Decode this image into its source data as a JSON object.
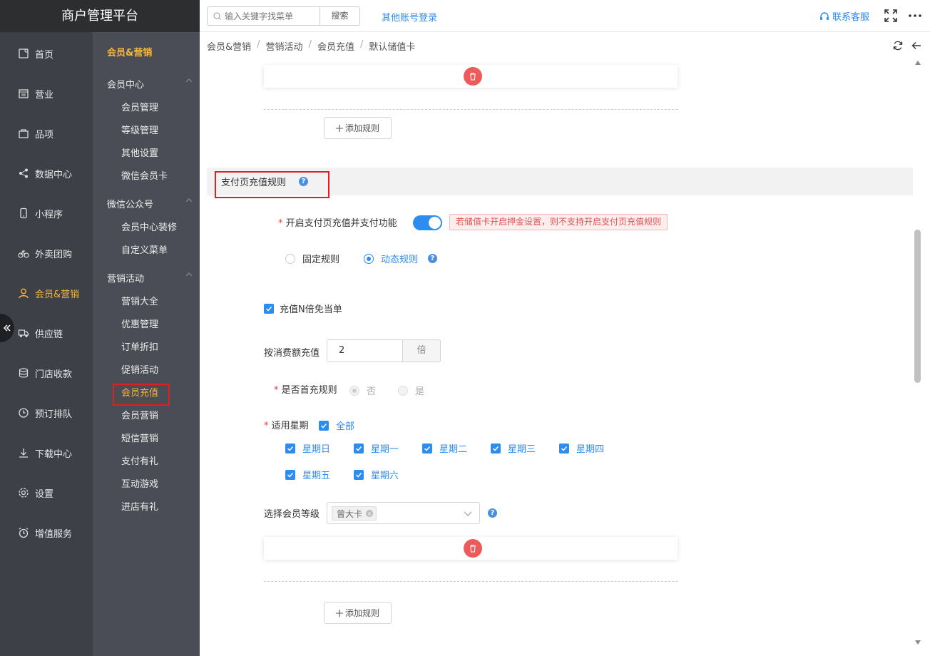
{
  "app": {
    "title": "商户管理平台"
  },
  "sidebar": {
    "items": [
      {
        "label": "首页",
        "icon": "home-icon"
      },
      {
        "label": "营业",
        "icon": "calendar-icon"
      },
      {
        "label": "品项",
        "icon": "bag-icon"
      },
      {
        "label": "数据中心",
        "icon": "share-icon"
      },
      {
        "label": "小程序",
        "icon": "phone-icon"
      },
      {
        "label": "外卖团购",
        "icon": "bike-icon"
      },
      {
        "label": "会员&营销",
        "icon": "user-icon",
        "active": true
      },
      {
        "label": "供应链",
        "icon": "truck-icon"
      },
      {
        "label": "门店收款",
        "icon": "database-icon"
      },
      {
        "label": "预订排队",
        "icon": "clock-icon"
      },
      {
        "label": "下载中心",
        "icon": "download-icon"
      },
      {
        "label": "设置",
        "icon": "gear-icon"
      },
      {
        "label": "增值服务",
        "icon": "alarm-icon"
      }
    ]
  },
  "subnav": {
    "title": "会员&营销",
    "groups": [
      {
        "label": "会员中心",
        "items": [
          "会员管理",
          "等级管理",
          "其他设置",
          "微信会员卡"
        ]
      },
      {
        "label": "微信公众号",
        "items": [
          "会员中心装修",
          "自定义菜单"
        ]
      },
      {
        "label": "营销活动",
        "items": [
          "营销大全",
          "优惠管理",
          "订单折扣",
          "促销活动",
          "会员充值",
          "会员营销",
          "短信营销",
          "支付有礼",
          "互动游戏",
          "进店有礼"
        ]
      }
    ],
    "active_item": "会员充值"
  },
  "header": {
    "search_placeholder": "输入关键字找菜单",
    "search_button": "搜索",
    "other_login": "其他账号登录",
    "service": "联系客服"
  },
  "breadcrumb": [
    "会员&营销",
    "营销活动",
    "会员充值",
    "默认储值卡"
  ],
  "content": {
    "add_rule": "添加规则",
    "section_title": "支付页充值规则",
    "enable_label": "开启支付页充值并支付功能",
    "enable_on": true,
    "warning": "若储值卡开启押金设置，则不支持开启支付页充值规则",
    "rule_types": [
      "固定规则",
      "动态规则"
    ],
    "rule_type_selected": "动态规则",
    "n_times_free": "充值N倍免当单",
    "consume_label": "按消费额充值",
    "consume_value": "2",
    "consume_unit": "倍",
    "first_charge_label": "是否首充规则",
    "first_charge_options": [
      "否",
      "是"
    ],
    "weekday_label": "适用星期",
    "weekday_all": "全部",
    "weekdays": [
      "星期日",
      "星期一",
      "星期二",
      "星期三",
      "星期四",
      "星期五",
      "星期六"
    ],
    "level_label": "选择会员等级",
    "level_tag": "曾大卡"
  },
  "colors": {
    "accent": "#2d8cf0",
    "active_nav": "#f5b73b",
    "delete": "#ee5a5a",
    "highlight_box": "#e02020"
  }
}
